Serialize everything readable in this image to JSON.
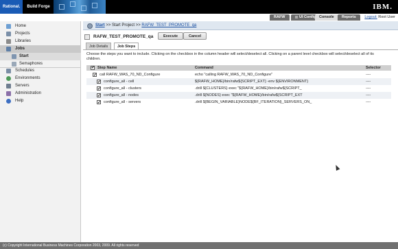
{
  "banner": {
    "brand_rational": "Rational.",
    "brand_product": "Build Forge",
    "ibm_logo": "IBM."
  },
  "topnav": {
    "tabs": [
      {
        "label": "RAFW"
      },
      {
        "label": "UI Config"
      },
      {
        "label": "Console"
      },
      {
        "label": "Reports"
      }
    ],
    "logout_label": "Logout:",
    "user": "Root User"
  },
  "sidebar": {
    "items": [
      {
        "label": "Home",
        "icon": "home-icon"
      },
      {
        "label": "Projects",
        "icon": "projects-icon"
      },
      {
        "label": "Libraries",
        "icon": "libraries-icon"
      },
      {
        "label": "Jobs",
        "icon": "jobs-icon"
      },
      {
        "label": "Start",
        "icon": "start-icon"
      },
      {
        "label": "Semaphores",
        "icon": "semaphores-icon"
      },
      {
        "label": "Schedules",
        "icon": "schedules-icon"
      },
      {
        "label": "Environments",
        "icon": "environments-icon"
      },
      {
        "label": "Servers",
        "icon": "servers-icon"
      },
      {
        "label": "Administration",
        "icon": "administration-icon"
      },
      {
        "label": "Help",
        "icon": "help-icon"
      }
    ]
  },
  "breadcrumb": {
    "start": "Start",
    "sep1": " >> ",
    "middle": "Start Project",
    "sep2": " >> ",
    "project": "RAFW_TEST_PROMOTE_qa"
  },
  "page": {
    "title": "RAFW_TEST_PROMOTE_qa",
    "execute_label": "Execute",
    "cancel_label": "Cancel",
    "subtabs": [
      {
        "label": "Job Details"
      },
      {
        "label": "Job Steps"
      }
    ],
    "instructions": "Choose the steps you want to include. Clicking on the checkbox in the column header will select/deselect all. Clicking on a parent level checkbox will select/deselect all of its children."
  },
  "table": {
    "headers": {
      "step": "Step Name",
      "command": "Command",
      "selector": "Selector"
    },
    "rows": [
      {
        "step": "call RAFW_WAS_70_ND_Configure",
        "command": "echo \"calling RAFW_WAS_70_ND_Configure\"",
        "selector": "----"
      },
      {
        "step": "configure_all - cell",
        "command": "${RAFW_HOME}/bin/rafw${SCRIPT_EXT} -env ${ENVIRONMENT}",
        "selector": "----"
      },
      {
        "step": "configure_all - clusters",
        "command": ".drill ${CLUSTERS} exec \"${RAFW_HOME}/bin/rafw${SCRIPT_",
        "selector": "----"
      },
      {
        "step": "configure_all - nodes",
        "command": ".drill ${NODES} exec \"${RAFW_HOME}/bin/rafw${SCRIPT_EXT",
        "selector": "----"
      },
      {
        "step": "configure_all - servers",
        "command": ".drill ${BEGIN_VARIABLE}NODE${BF_ITERATION}_SERVERS_ON_",
        "selector": "----"
      }
    ]
  },
  "footer": {
    "text": "(c) Copyright International Business Machines Corporation 2003, 2009. All rights reserved"
  },
  "colors": {
    "banner": "#000000",
    "rational_blue": "#1a5bb5",
    "link": "#1a4fa0",
    "footer": "#707070"
  }
}
